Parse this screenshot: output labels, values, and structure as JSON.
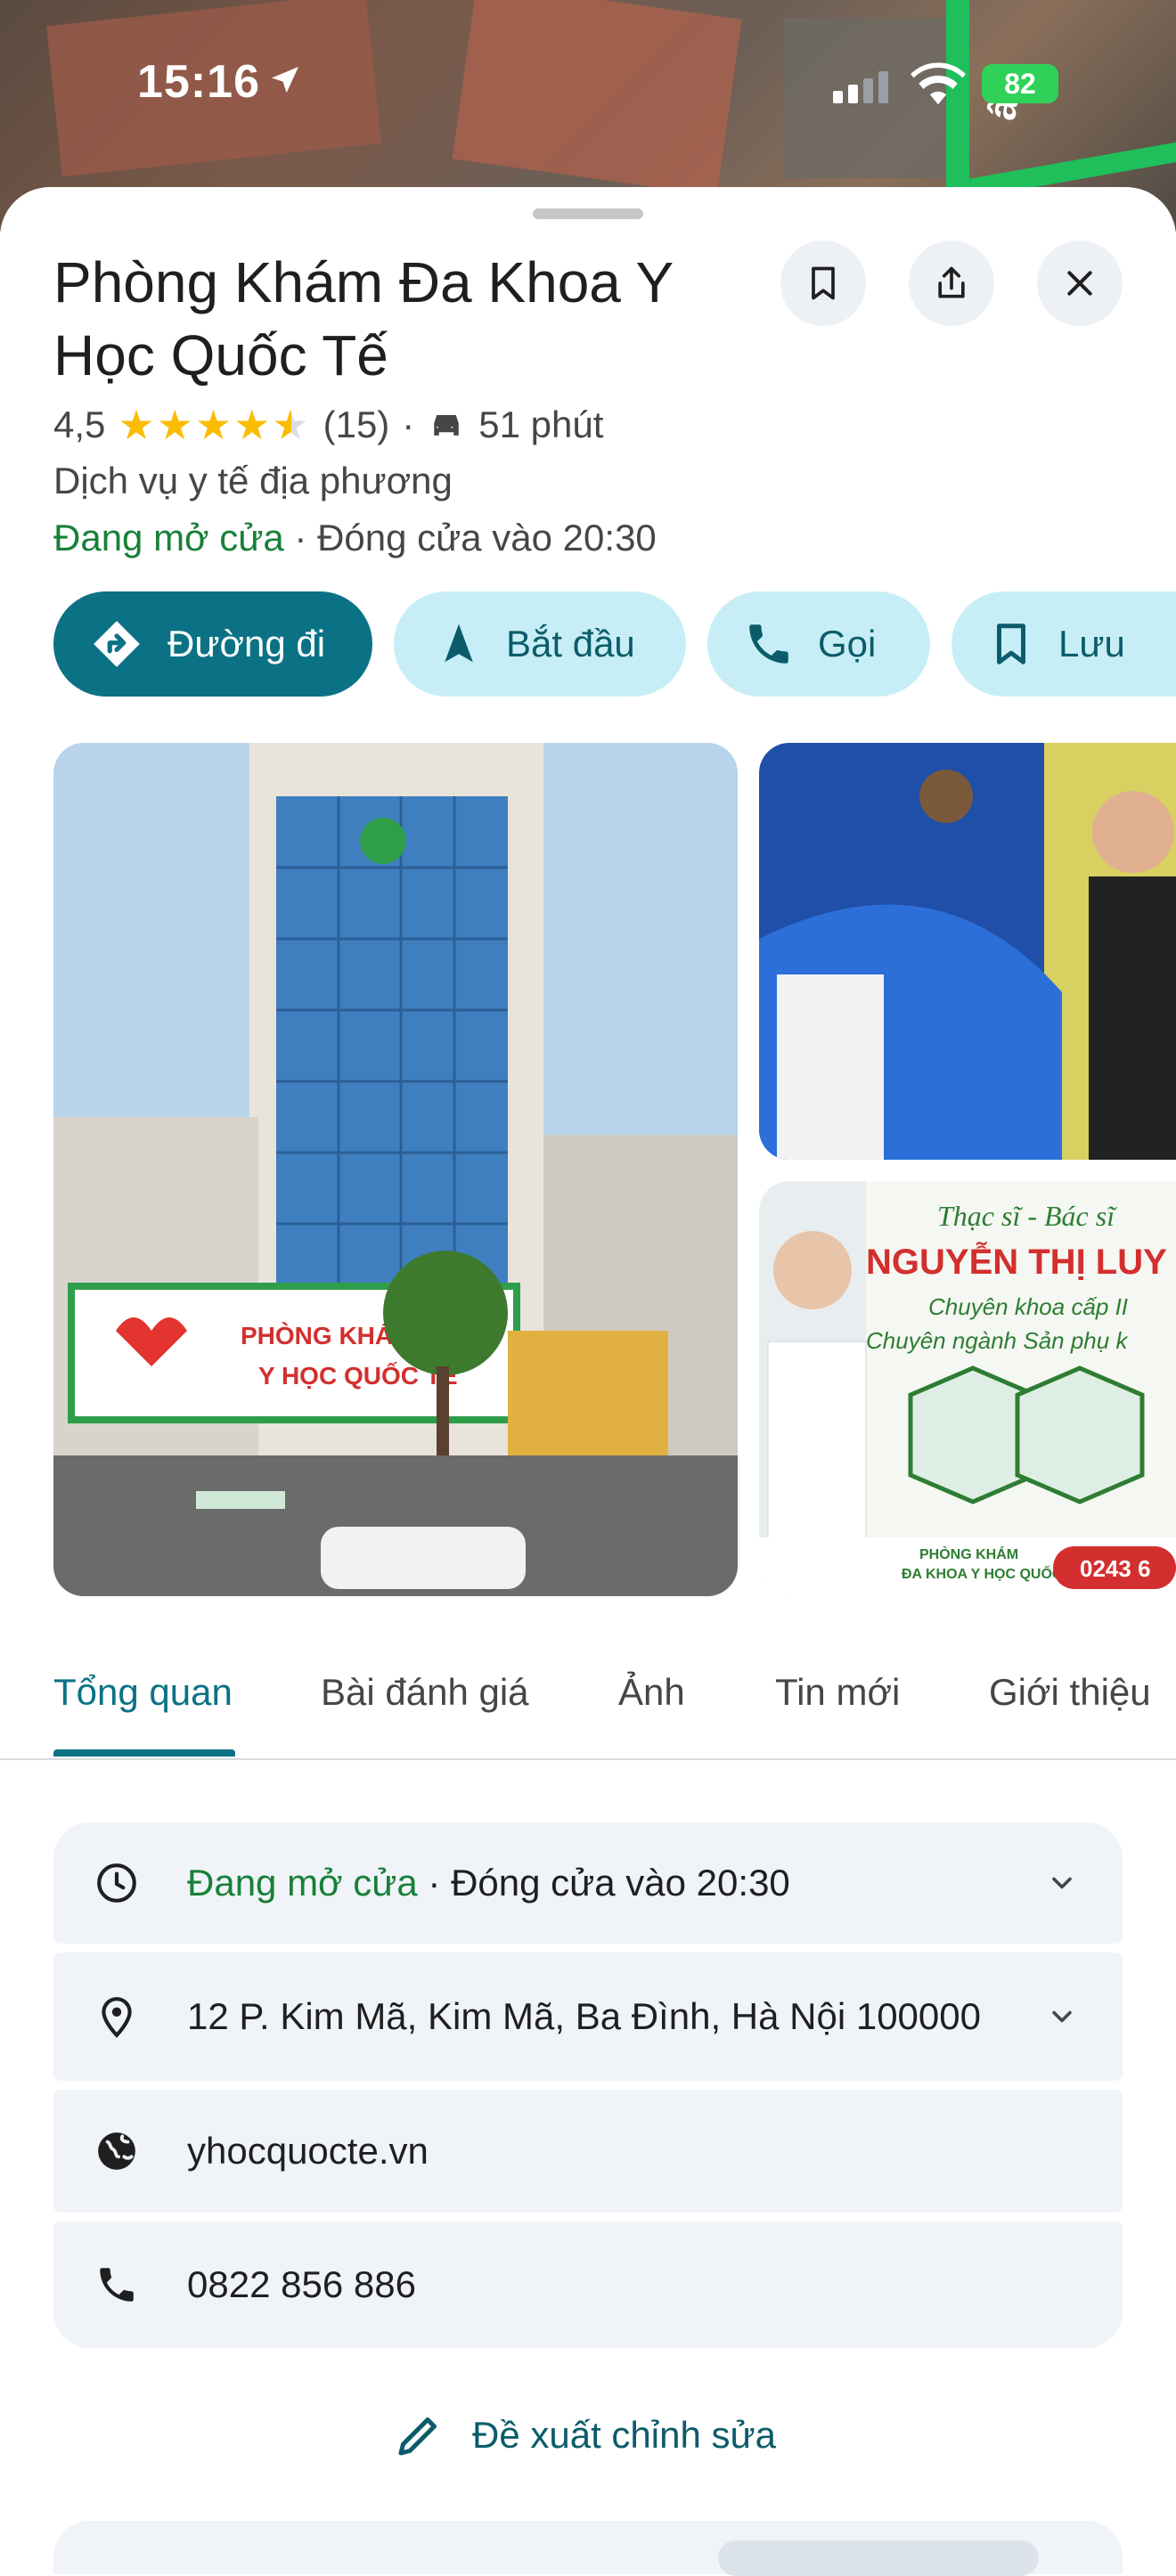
{
  "status_bar": {
    "time": "15:16",
    "battery": "82"
  },
  "map": {
    "road_label": "ây"
  },
  "place": {
    "name": "Phòng Khám Đa Khoa Y Học Quốc Tế",
    "rating": "4,5",
    "stars_value": 4.5,
    "review_count": "(15)",
    "separator": "·",
    "drive_time": "51 phút",
    "category": "Dịch vụ y tế địa phương",
    "open_status": "Đang mở cửa",
    "close_info": " · Đóng cửa vào 20:30"
  },
  "actions": [
    {
      "label": "Đường đi",
      "icon": "directions-icon"
    },
    {
      "label": "Bắt đầu",
      "icon": "navigation-icon"
    },
    {
      "label": "Gọi",
      "icon": "phone-icon"
    },
    {
      "label": "Lưu",
      "icon": "bookmark-icon"
    }
  ],
  "photos": {
    "main_sign_1": "PHÒNG KHÁM",
    "main_sign_2": "Y HỌC QUỐC TẾ",
    "banner_title": "Thạc sĩ - Bác sĩ",
    "banner_name": "NGUYỄN THỊ LUY",
    "banner_line1": "Chuyên khoa cấp II",
    "banner_line2": "Chuyên ngành Sản phụ k",
    "banner_footer_1": "PHÒNG KHÁM",
    "banner_footer_2": "ĐA KHOA Y HỌC QUỐC TẾ",
    "banner_phone": "0243 6"
  },
  "tabs": [
    "Tổng quan",
    "Bài đánh giá",
    "Ảnh",
    "Tin mới",
    "Giới thiệu"
  ],
  "info": {
    "hours_open": "Đang mở cửa",
    "hours_close": " · Đóng cửa vào 20:30",
    "address": "12 P. Kim Mã, Kim Mã, Ba Đình, Hà Nội 100000",
    "website": "yhocquocte.vn",
    "phone": "0822 856 886"
  },
  "suggest_edit": "Đề xuất chỉnh sửa",
  "colors": {
    "primary": "#0b7285",
    "chip_bg": "#c7eef6",
    "open_green": "#188038",
    "star": "#fbbc04"
  }
}
